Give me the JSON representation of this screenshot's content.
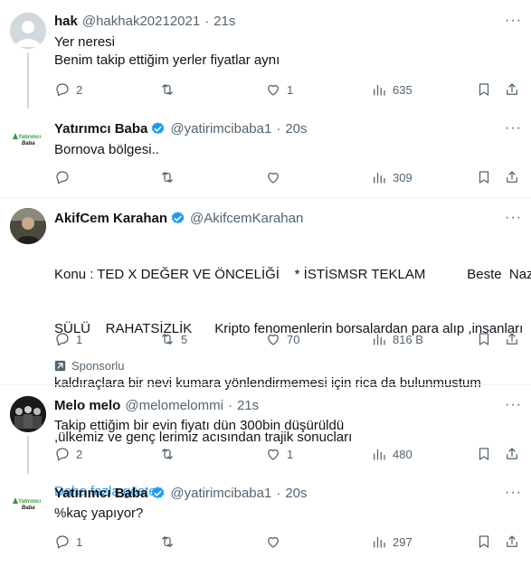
{
  "tweets": [
    {
      "name": "hak",
      "handle": "@hakhak20212021",
      "sep": "·",
      "time": "21s",
      "verified": false,
      "lines": [
        "Yer neresi",
        "Benim takip ettiğim yerler fiyatlar aynı"
      ],
      "reply_count": "2",
      "retweet_count": "",
      "like_count": "1",
      "view_count": "635"
    },
    {
      "name": "Yatırımcı Baba",
      "handle": "@yatirimcibaba1",
      "sep": "·",
      "time": "20s",
      "verified": true,
      "avatar_logo_text": "Yatırımcı Baba",
      "lines": [
        "Bornova bölgesi.."
      ],
      "reply_count": "",
      "retweet_count": "",
      "like_count": "",
      "view_count": "309"
    },
    {
      "name": "AkifCem Karahan",
      "handle": "@AkifcemKarahan",
      "verified": true,
      "lines": [
        "Konu : TED X DEĞER VE ÖNCELİĞİ    * İSTİSMSR TEKLAM           Beste  Naz",
        "SÜLÜ    RAHATSİZLİK      Kripto fenomenlerin borsalardan para alıp ,insanları",
        "kaldıraçlara bir nevi kumara yönlendirmemesi için rica da bulunmustum",
        ",ülkemiz ve genç lerimiz acısından trajik sonucları"
      ],
      "show_more": "Daha fazla göster",
      "reply_count": "1",
      "retweet_count": "5",
      "like_count": "70",
      "view_count": "816 B",
      "sponsored_label": "Sponsorlu"
    },
    {
      "name": "Melo melo",
      "handle": "@melomelommi",
      "sep": "·",
      "time": "21s",
      "verified": false,
      "lines": [
        "Takip ettiğim bir evin fiyatı dün 300bin düşürüldü"
      ],
      "reply_count": "2",
      "retweet_count": "",
      "like_count": "1",
      "view_count": "480"
    },
    {
      "name": "Yatırımcı Baba",
      "handle": "@yatirimcibaba1",
      "sep": "·",
      "time": "20s",
      "verified": true,
      "avatar_logo_text": "Yatırımcı Baba",
      "lines": [
        "%kaç yapıyor?"
      ],
      "reply_count": "1",
      "retweet_count": "",
      "like_count": "",
      "view_count": "297"
    }
  ],
  "more_glyph": "···",
  "colors": {
    "accent": "#1d9bf0",
    "muted": "#536471",
    "text": "#0f1419",
    "logo_green": "#2e9a3a"
  }
}
